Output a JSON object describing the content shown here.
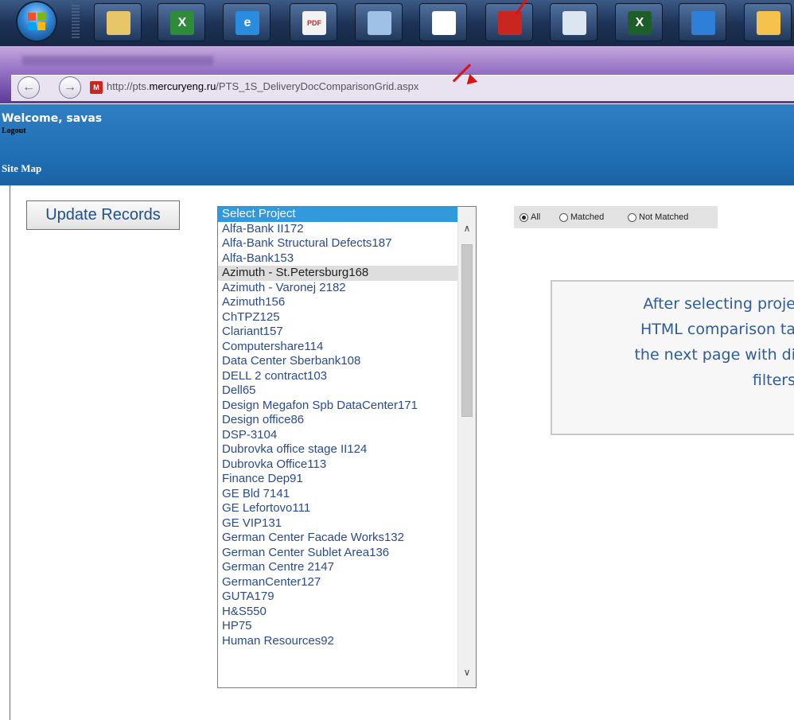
{
  "taskbar": {
    "buttons": [
      {
        "name": "file-explorer-icon",
        "glyph": "",
        "color": "#e7c66a"
      },
      {
        "name": "excel-icon",
        "glyph": "X",
        "color": "#2e8b3a"
      },
      {
        "name": "internet-explorer-icon",
        "glyph": "e",
        "color": "#2a8cde"
      },
      {
        "name": "pdf-fill-icon",
        "glyph": "PDF",
        "color": "#f2f2f2"
      },
      {
        "name": "notepad-icon",
        "glyph": "",
        "color": "#9fc1e6"
      },
      {
        "name": "app-icon",
        "glyph": "",
        "color": "#ffffff"
      },
      {
        "name": "acrobat-icon",
        "glyph": "",
        "color": "#c8261e"
      },
      {
        "name": "calculator-icon",
        "glyph": "",
        "color": "#dce6f2"
      },
      {
        "name": "project-icon",
        "glyph": "X",
        "color": "#1d5e2a"
      },
      {
        "name": "teamviewer-icon",
        "glyph": "",
        "color": "#2d7fd8"
      },
      {
        "name": "outlook-icon",
        "glyph": "",
        "color": "#f4c24d"
      }
    ]
  },
  "browser": {
    "url_prefix": "http://pts.",
    "url_domain": "mercuryeng.ru",
    "url_path": "/PTS_1S_DeliveryDocComparisonGrid.aspx"
  },
  "header": {
    "welcome": "Welcome, savas",
    "logout": "Logout",
    "sitemap": "Site Map"
  },
  "main": {
    "update_button": "Update Records",
    "project_list": [
      "Select Project",
      "Alfa-Bank II172",
      "Alfa-Bank Structural Defects187",
      "Alfa-Bank153",
      "Azimuth - St.Petersburg168",
      "Azimuth - Varonej 2182",
      "Azimuth156",
      "ChTPZ125",
      "Clariant157",
      "Computershare114",
      "Data Center Sberbank108",
      "DELL 2 contract103",
      "Dell65",
      "Design Megafon Spb DataCenter171",
      "Design office86",
      "DSP-3104",
      "Dubrovka office stage II124",
      "Dubrovka Office113",
      "Finance Dep91",
      "GE Bld 7141",
      "GE Lefortovo111",
      "GE VIP131",
      "German Center Facade Works132",
      "German Center Sublet Area136",
      "German Centre 2147",
      "GermanCenter127",
      "GUTA179",
      "H&S550",
      "HP75",
      "Human Resources92"
    ],
    "selected_index": 0,
    "highlighted_index": 4,
    "filters": {
      "all": "All",
      "matched": "Matched",
      "not_matched": "Not Matched",
      "checked": "all"
    },
    "callout_lines": [
      "After selecting proje",
      "HTML comparison ta",
      "the next page with di",
      "filters"
    ]
  }
}
